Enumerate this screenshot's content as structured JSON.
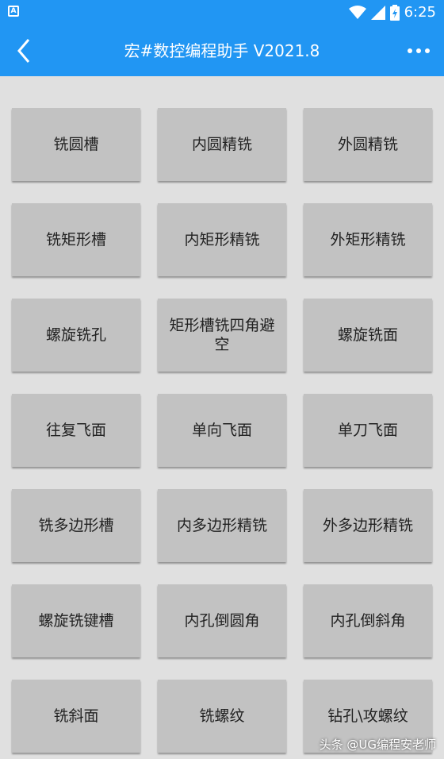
{
  "status": {
    "app_icon_letter": "A",
    "battery_level": "6",
    "time": "6:25"
  },
  "toolbar": {
    "title": "宏#数控编程助手 V2021.8"
  },
  "buttons": [
    "铣圆槽",
    "内圆精铣",
    "外圆精铣",
    "铣矩形槽",
    "内矩形精铣",
    "外矩形精铣",
    "螺旋铣孔",
    "矩形槽铣四角避空",
    "螺旋铣面",
    "往复飞面",
    "单向飞面",
    "单刀飞面",
    "铣多边形槽",
    "内多边形精铣",
    "外多边形精铣",
    "螺旋铣键槽",
    "内孔倒圆角",
    "内孔倒斜角",
    "铣斜面",
    "铣螺纹",
    "钻孔\\攻螺纹"
  ],
  "watermark": "头条 @UG编程安老师",
  "colors": {
    "primary": "#2196f3",
    "button": "#c2c2c2",
    "background": "#e0e0e0"
  }
}
